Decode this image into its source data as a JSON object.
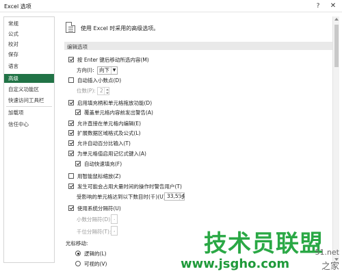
{
  "window": {
    "title": "Excel 选项",
    "help": "?",
    "close": "✕"
  },
  "sidebar": {
    "items": [
      {
        "label": "常规"
      },
      {
        "label": "公式"
      },
      {
        "label": "校对"
      },
      {
        "label": "保存"
      },
      {
        "label": "语言"
      },
      {
        "label": "高级",
        "selected": true
      },
      {
        "label": "自定义功能区"
      },
      {
        "label": "快速访问工具栏"
      },
      {
        "label": "加载项"
      },
      {
        "label": "信任中心"
      }
    ]
  },
  "main": {
    "header": "使用 Excel 时采用的高级选项。",
    "section": "编辑选项",
    "options": {
      "enter_move": {
        "label": "按 Enter 键后移动所选内容(M)",
        "checked": true
      },
      "direction": {
        "label": "方向(I):",
        "value": "向下"
      },
      "auto_decimal": {
        "label": "自动插入小数点(D)",
        "checked": false
      },
      "places": {
        "label": "位数(P):",
        "value": "2"
      },
      "fill_handle": {
        "label": "启用填充柄和单元格拖放功能(D)",
        "checked": true
      },
      "overwrite_alert": {
        "label": "覆盖单元格内容前发出警告(A)",
        "checked": true
      },
      "edit_in_cell": {
        "label": "允许直接在单元格内编辑(E)",
        "checked": true
      },
      "extend_formats": {
        "label": "扩展数据区域格式及公式(L)",
        "checked": true
      },
      "auto_percent": {
        "label": "允许自动百分比输入(T)",
        "checked": true
      },
      "autocomplete": {
        "label": "为单元格值启用记忆式键入(A)",
        "checked": true
      },
      "flash_fill": {
        "label": "自动快速填充(F)",
        "checked": true
      },
      "intellimouse": {
        "label": "用智能鼠标缩放(Z)",
        "checked": false
      },
      "large_op_alert": {
        "label": "发生可能会占用大量时间的操作时警告用户(T)",
        "checked": true
      },
      "cells_affected": {
        "label": "受影响的单元格达到以下数目时(千)(U):",
        "value": "33,554"
      },
      "system_separators": {
        "label": "使用系统分隔符(U)",
        "checked": true
      },
      "decimal_sep": {
        "label": "小数分隔符(D):",
        "value": "."
      },
      "thousands_sep": {
        "label": "千位分隔符(T):",
        "value": ","
      },
      "cursor_move": {
        "label": "光标移动:"
      },
      "logical": {
        "label": "逻辑的(L)",
        "selected": true
      },
      "visual": {
        "label": "可视的(V)",
        "selected": false
      }
    }
  },
  "watermark": {
    "main": "技术员联盟",
    "url": "www.jsgho.com",
    "side1": "51.net",
    "side2": "之家"
  },
  "icons": {
    "header": "document-icon",
    "help": "help-icon",
    "close": "close-icon"
  }
}
